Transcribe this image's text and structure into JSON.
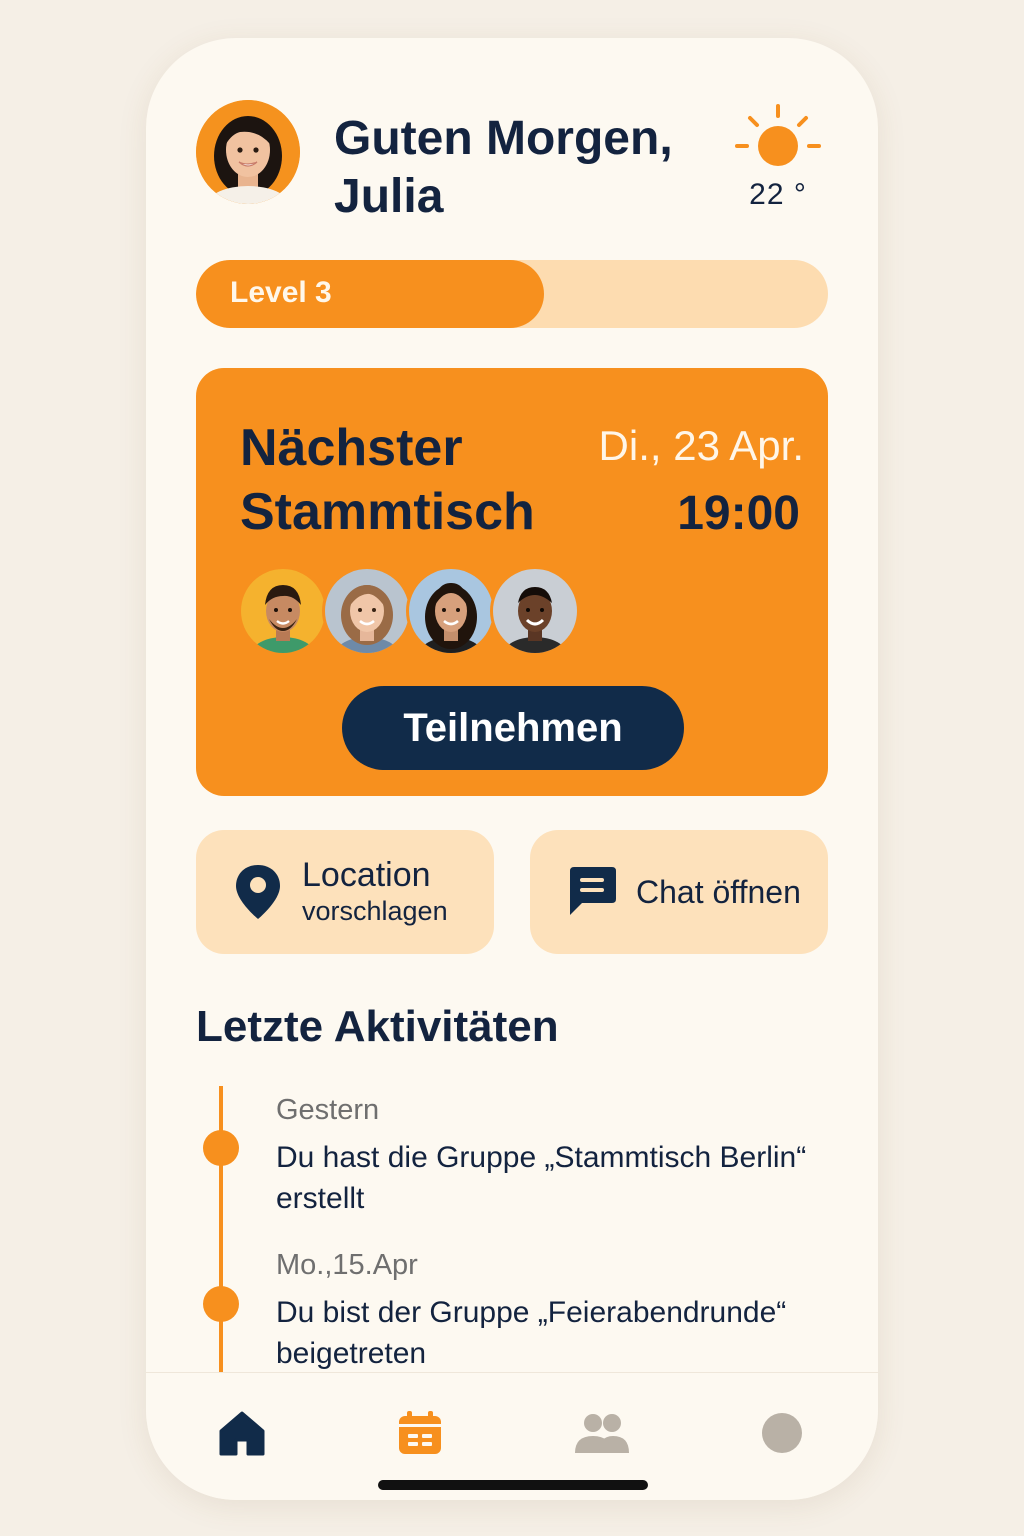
{
  "header": {
    "greeting_line1": "Guten Morgen,",
    "greeting_line2": "Julia",
    "avatar_icon": "user-avatar-woman"
  },
  "weather": {
    "icon": "sun-icon",
    "temperature": "22 °"
  },
  "level": {
    "label": "Level 3",
    "progress_fraction": 0.55
  },
  "event": {
    "title_line1": "Nächster",
    "title_line2": "Stammtisch",
    "date": "Di., 23 Apr.",
    "time": "19:00",
    "participants_count": 4,
    "join_label": "Teilnehmen"
  },
  "actions": {
    "location": {
      "icon": "location-pin-icon",
      "line1": "Location",
      "line2": "vorschlagen"
    },
    "chat": {
      "icon": "chat-bubble-icon",
      "label": "Chat öffnen"
    }
  },
  "activities": {
    "title": "Letzte Aktivitäten",
    "items": [
      {
        "date": "Gestern",
        "text": "Du hast die Gruppe „Stammtisch Berlin“ erstellt"
      },
      {
        "date": "Mo.,15.Apr",
        "text": "Du bist der Gruppe „Feierabendrunde“ beigetreten"
      }
    ]
  },
  "nav": {
    "items": [
      {
        "icon": "home-icon",
        "active": true
      },
      {
        "icon": "calendar-icon",
        "active": false
      },
      {
        "icon": "group-icon",
        "active": false
      },
      {
        "icon": "profile-icon",
        "active": false
      }
    ]
  },
  "colors": {
    "accent": "#f7901e",
    "navy": "#112b49",
    "background": "#fdf9f1",
    "tile": "#fde1bb"
  }
}
